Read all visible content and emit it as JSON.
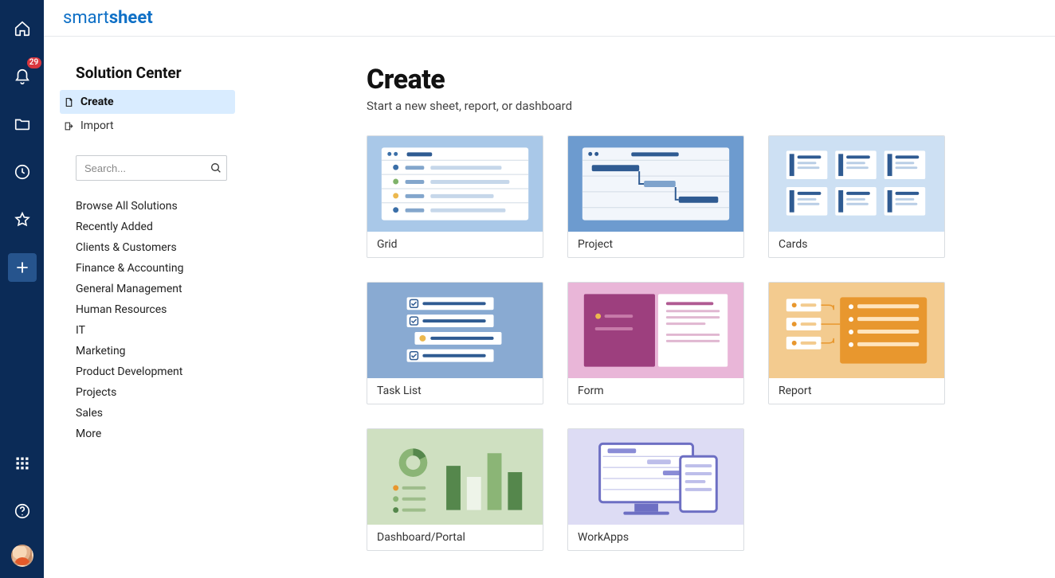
{
  "brand": {
    "first": "smart",
    "second": "sheet"
  },
  "rail": {
    "notification_count": "29"
  },
  "panel": {
    "title": "Solution Center",
    "nav": {
      "create": "Create",
      "import": "Import"
    },
    "search_placeholder": "Search...",
    "categories": [
      "Browse All Solutions",
      "Recently Added",
      "Clients & Customers",
      "Finance & Accounting",
      "General Management",
      "Human Resources",
      "IT",
      "Marketing",
      "Product Development",
      "Projects",
      "Sales",
      "More"
    ]
  },
  "main": {
    "title": "Create",
    "subtitle": "Start a new sheet, report, or dashboard",
    "tiles": [
      {
        "id": "grid",
        "label": "Grid"
      },
      {
        "id": "project",
        "label": "Project"
      },
      {
        "id": "cards",
        "label": "Cards"
      },
      {
        "id": "tasklist",
        "label": "Task List"
      },
      {
        "id": "form",
        "label": "Form"
      },
      {
        "id": "report",
        "label": "Report"
      },
      {
        "id": "dashboard",
        "label": "Dashboard/Portal"
      },
      {
        "id": "workapps",
        "label": "WorkApps"
      }
    ]
  }
}
